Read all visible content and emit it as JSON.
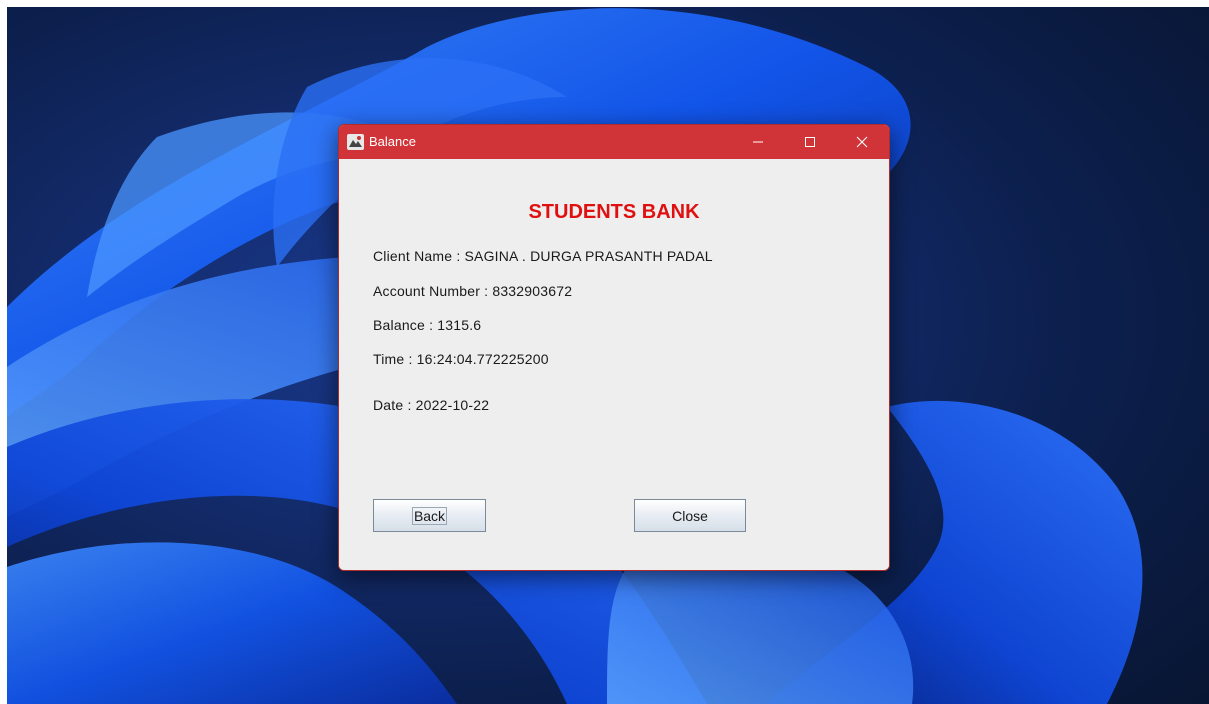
{
  "window": {
    "title": "Balance",
    "icon": "java-app-icon",
    "controls": [
      "minimize-icon",
      "maximize-icon",
      "close-icon"
    ],
    "titlebar_color": "#d13438"
  },
  "content": {
    "bank_title": "STUDENTS BANK",
    "bank_title_color": "#e01010",
    "client_name": "Client Name : SAGINA . DURGA PRASANTH PADAL",
    "account_number": "Account Number : 8332903672",
    "balance": "Balance : 1315.6",
    "time": "Time : 16:24:04.772225200",
    "date": "Date : 2022-10-22"
  },
  "buttons": {
    "back_label": "Back",
    "close_label": "Close"
  }
}
